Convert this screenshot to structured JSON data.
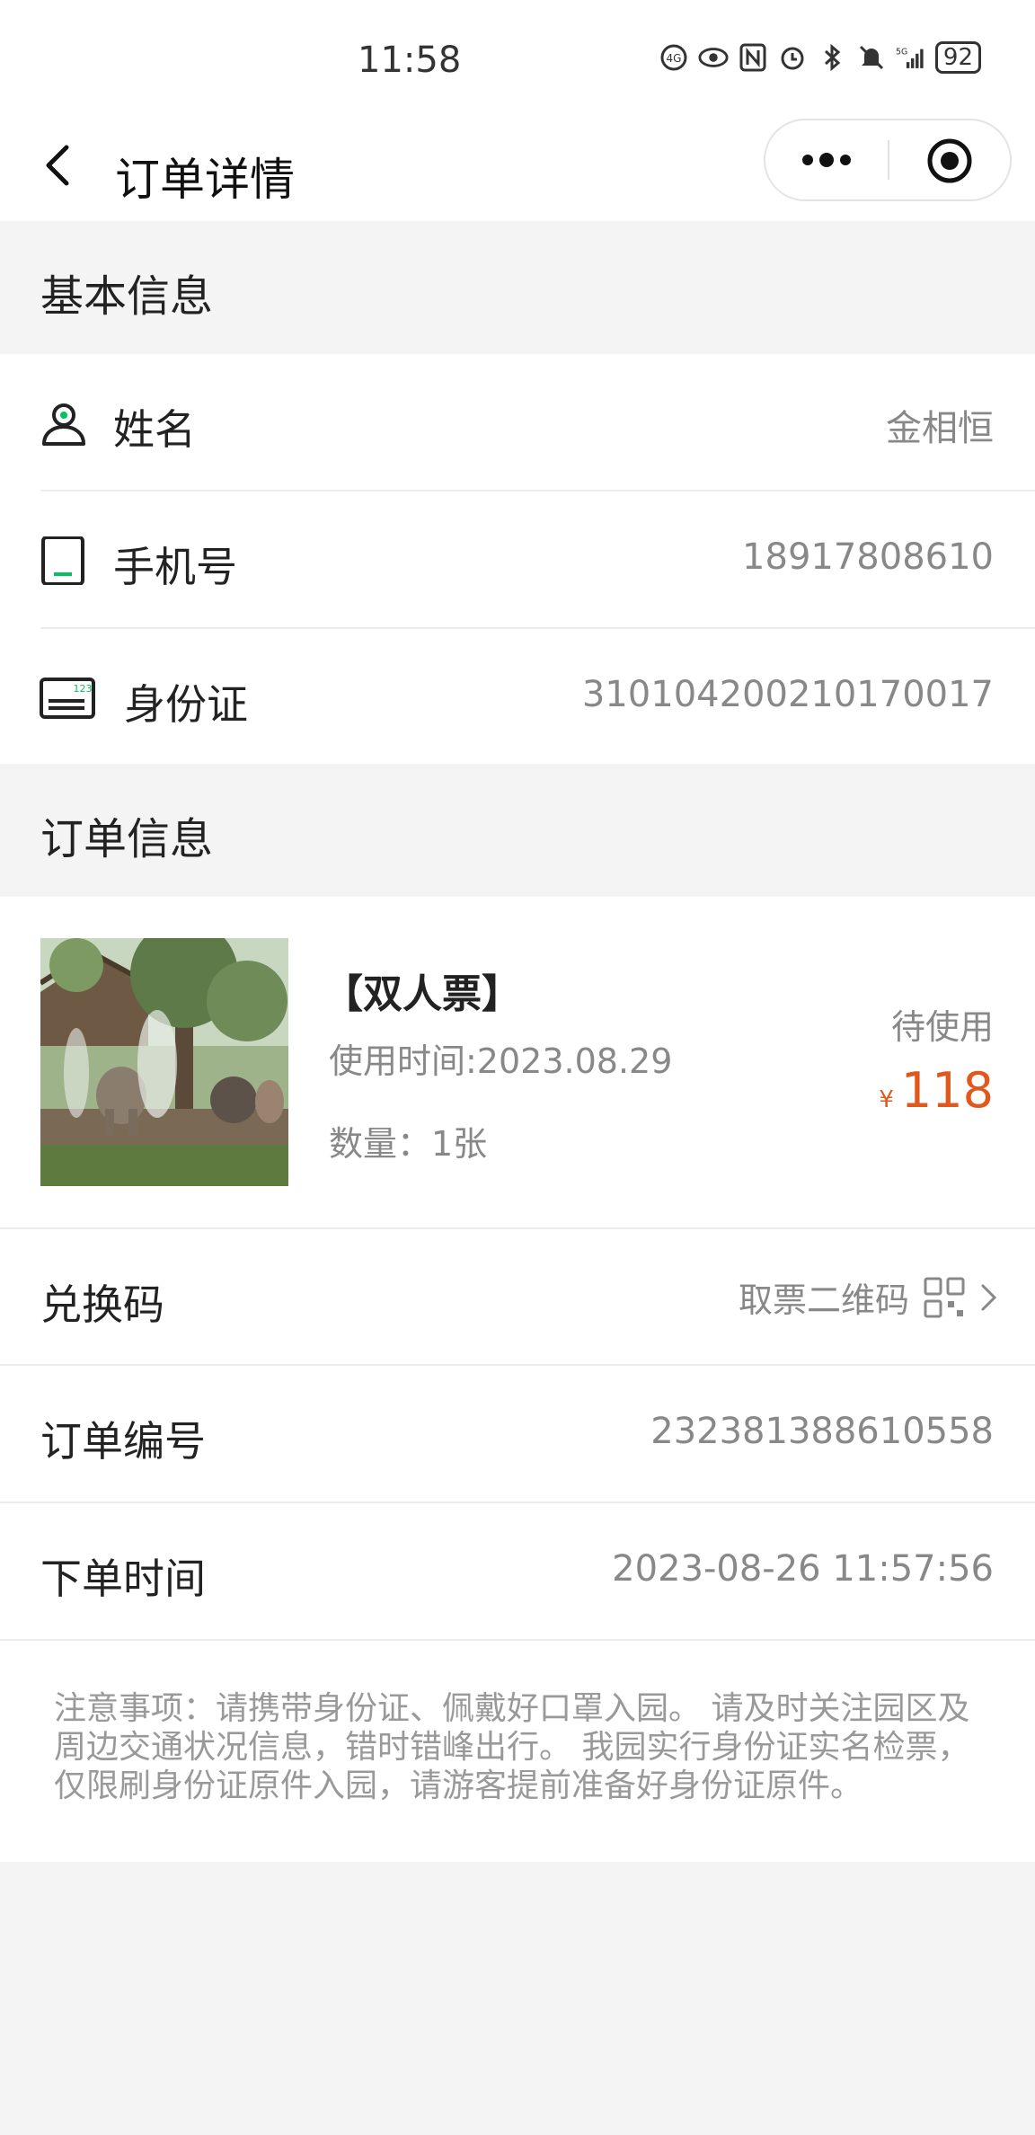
{
  "status_bar": {
    "time": "11:58",
    "battery": "92"
  },
  "nav": {
    "title": "订单详情"
  },
  "basic_section": {
    "header": "基本信息",
    "name_label": "姓名",
    "name_value": "金相恒",
    "phone_label": "手机号",
    "phone_value": "18917808610",
    "id_label": "身份证",
    "id_value": "310104200210170017",
    "id_icon_text": "123"
  },
  "order_section": {
    "header": "订单信息",
    "product": {
      "name": "【双人票】",
      "use_date": "使用时间:2023.08.29",
      "quantity": "数量：1张",
      "status": "待使用",
      "currency": "¥",
      "price": "118"
    },
    "redeem_label": "兑换码",
    "redeem_link": "取票二维码",
    "order_no_label": "订单编号",
    "order_no_value": "232381388610558",
    "order_time_label": "下单时间",
    "order_time_value": "2023-08-26 11:57:56"
  },
  "notice": "注意事项：请携带身份证、佩戴好口罩入园。 请及时关注园区及周边交通状况信息，错时错峰出行。 我园实行身份证实名检票，仅限刷身份证原件入园，请游客提前准备好身份证原件。",
  "colors": {
    "accent_green": "#07c160",
    "price_orange": "#e0581d"
  }
}
